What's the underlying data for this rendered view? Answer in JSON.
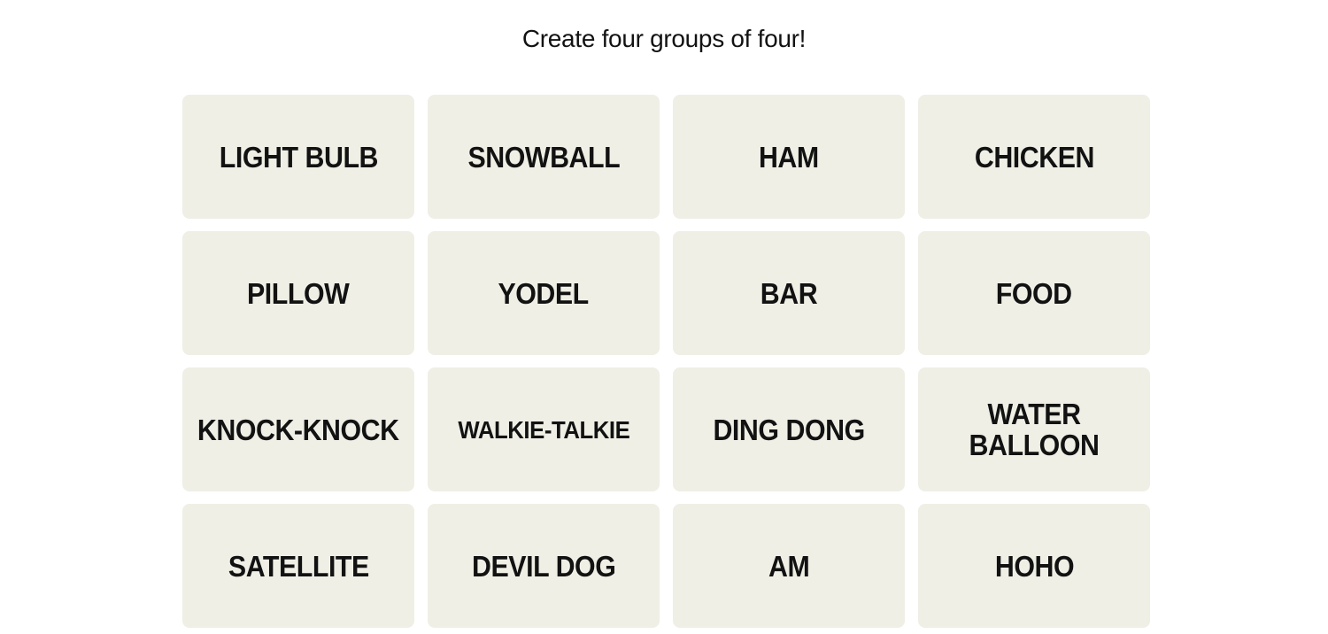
{
  "header": {
    "subtitle": "Create four groups of four!"
  },
  "board": {
    "tiles": [
      "LIGHT BULB",
      "SNOWBALL",
      "HAM",
      "CHICKEN",
      "PILLOW",
      "YODEL",
      "BAR",
      "FOOD",
      "KNOCK-KNOCK",
      "WALKIE-TALKIE",
      "DING DONG",
      "WATER BALLOON",
      "SATELLITE",
      "DEVIL DOG",
      "AM",
      "HOHO"
    ]
  },
  "colors": {
    "tile_background": "#efefe6",
    "text": "#121212",
    "page_background": "#ffffff"
  }
}
